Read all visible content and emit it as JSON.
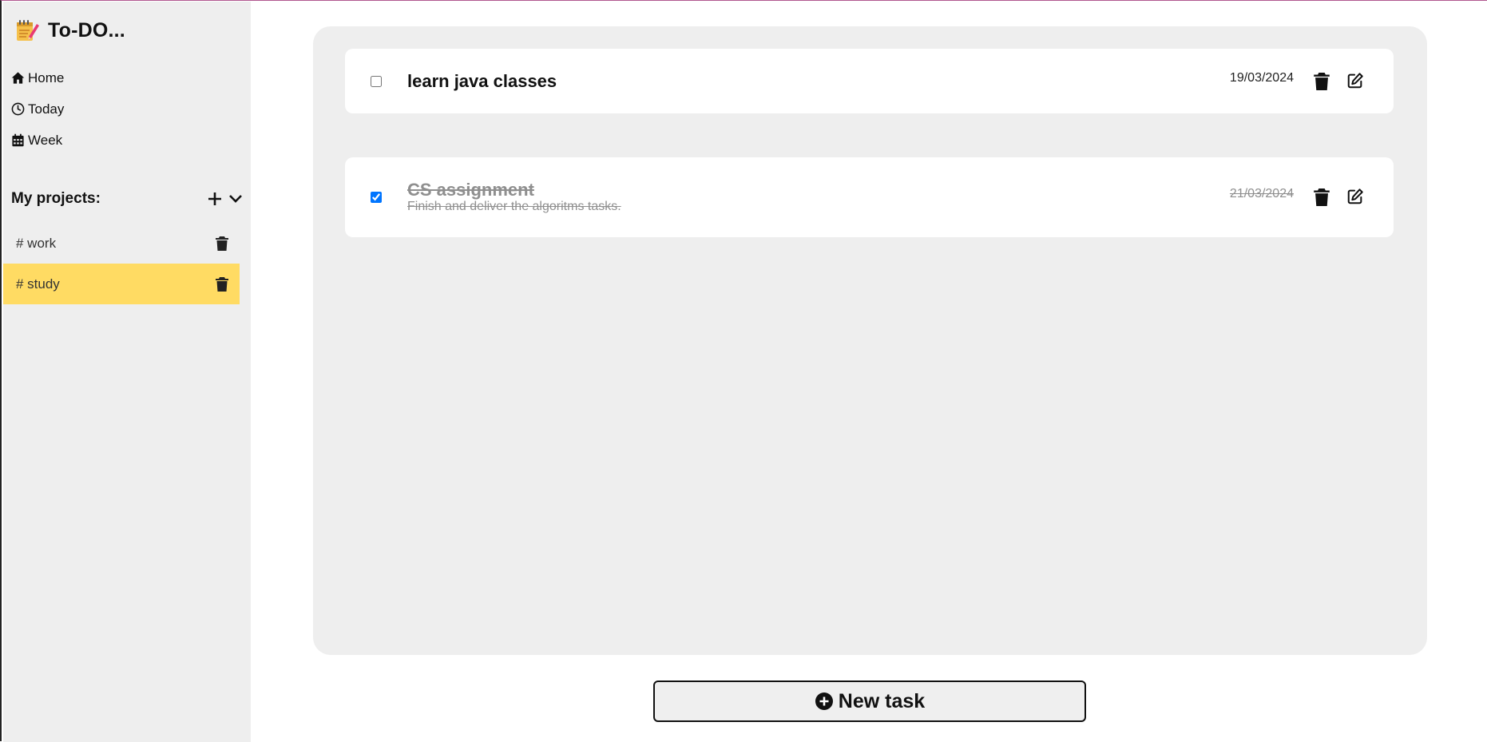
{
  "app": {
    "title": "To-DO..."
  },
  "nav": {
    "items": [
      {
        "label": "Home",
        "icon": "home-icon"
      },
      {
        "label": "Today",
        "icon": "clock-icon"
      },
      {
        "label": "Week",
        "icon": "calendar-icon"
      }
    ]
  },
  "projects": {
    "title": "My projects:",
    "items": [
      {
        "label": "# work",
        "active": false
      },
      {
        "label": "# study",
        "active": true
      }
    ]
  },
  "tasks": [
    {
      "title": "learn java classes",
      "description": "",
      "date": "19/03/2024",
      "completed": false
    },
    {
      "title": "CS assignment",
      "description": "Finish and deliver the algoritms tasks.",
      "date": "21/03/2024",
      "completed": true
    }
  ],
  "actions": {
    "new_task_label": "New task"
  },
  "colors": {
    "active_project": "#ffdb63",
    "panel_bg": "#eeeeee",
    "completed_text": "#8f8f8f"
  }
}
